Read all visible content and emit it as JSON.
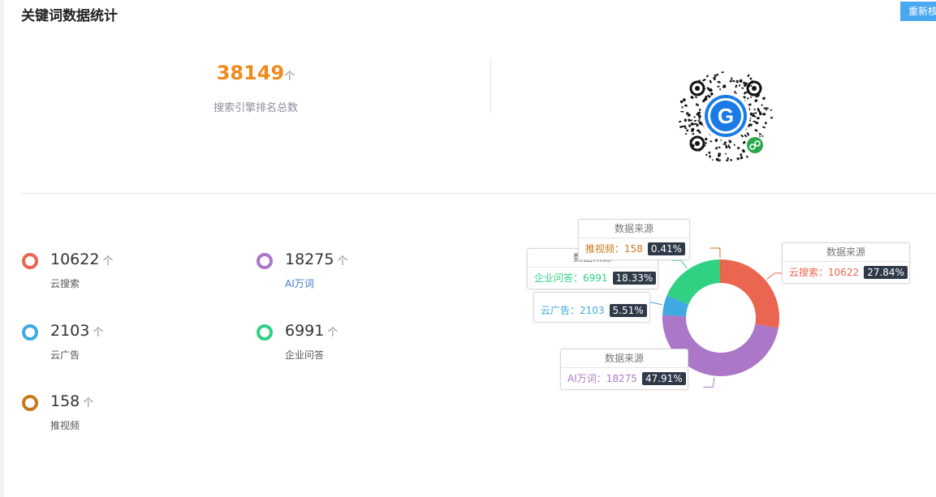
{
  "header": {
    "title": "关键词数据统计",
    "refresh_label": "重新核"
  },
  "summary": {
    "total_value": "38149",
    "total_unit": "个",
    "total_label": "搜索引擎排名总数"
  },
  "qr": {
    "icon": "mini-program-qr-code-icon",
    "logo_letter": "G"
  },
  "stats": [
    {
      "value": "10622",
      "unit": "个",
      "label": "云搜索",
      "color": "#ea6650"
    },
    {
      "value": "18275",
      "unit": "个",
      "label": "AI万词",
      "color": "#ab77c8"
    },
    {
      "value": "2103",
      "unit": "个",
      "label": "云广告",
      "color": "#3fa9e2"
    },
    {
      "value": "6991",
      "unit": "个",
      "label": "企业问答",
      "color": "#30d183"
    },
    {
      "value": "158",
      "unit": "个",
      "label": "推视频",
      "color": "#c9781b"
    }
  ],
  "chart_data": {
    "type": "pie",
    "variant": "donut",
    "series_name": "数据来源",
    "slices": [
      {
        "name": "云搜索",
        "value": 10622,
        "percent": "27.84%",
        "color": "#ea6650"
      },
      {
        "name": "AI万词",
        "value": 18275,
        "percent": "47.91%",
        "color": "#ab77c8"
      },
      {
        "name": "云广告",
        "value": 2103,
        "percent": "5.51%",
        "color": "#3fa9e2"
      },
      {
        "name": "企业问答",
        "value": 6991,
        "percent": "18.33%",
        "color": "#30d183"
      },
      {
        "name": "推视频",
        "value": 158,
        "percent": "0.41%",
        "color": "#c9781b"
      }
    ]
  },
  "tooltips": {
    "cloud_search": {
      "head": "数据来源",
      "text": "云搜索：10622",
      "pct": "27.84%"
    },
    "ai_words": {
      "head": "数据来源",
      "text": "AI万词：18275",
      "pct": "47.91%"
    },
    "cloud_ads": {
      "text": "云广告：2103",
      "pct": "5.51%"
    },
    "qa": {
      "head": "数据来源",
      "text": "企业问答：6991",
      "pct": "18.33%"
    },
    "video": {
      "head": "数据来源",
      "text": "推视频：158",
      "pct": "0.41%"
    }
  }
}
